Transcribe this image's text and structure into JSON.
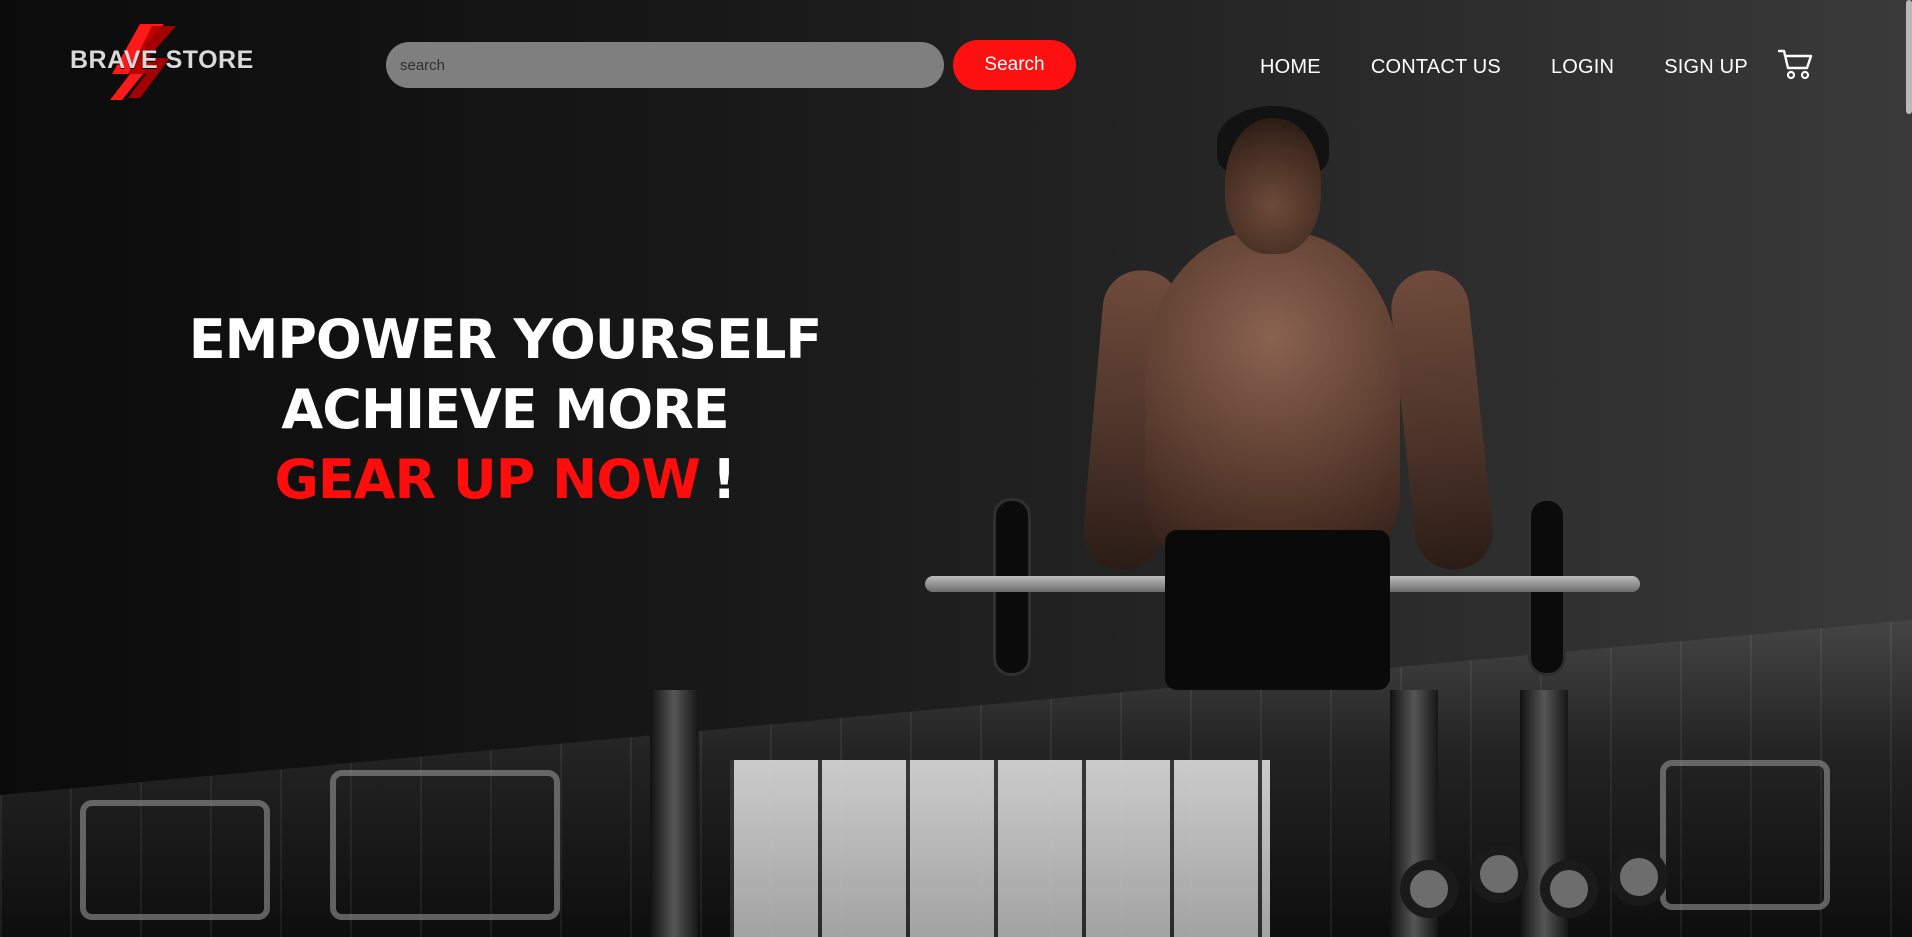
{
  "brand": {
    "name": "BRAVE STORE",
    "mark_colors": [
      "#ff1a1a",
      "#b30000"
    ]
  },
  "search": {
    "placeholder": "search",
    "button_label": "Search"
  },
  "nav": {
    "items": [
      {
        "label": "HOME"
      },
      {
        "label": "CONTACT US"
      },
      {
        "label": "LOGIN"
      },
      {
        "label": "SIGN UP"
      }
    ],
    "cart_icon": "cart-icon"
  },
  "hero": {
    "line_1": "EMPOWER YOURSELF",
    "line_2": "ACHIEVE MORE",
    "line_3": "GEAR UP NOW",
    "line_3_end": "!"
  },
  "colors": {
    "accent": "#ff1010",
    "text": "#ffffff",
    "background": "#111111",
    "search_field": "#7f7f7f"
  }
}
